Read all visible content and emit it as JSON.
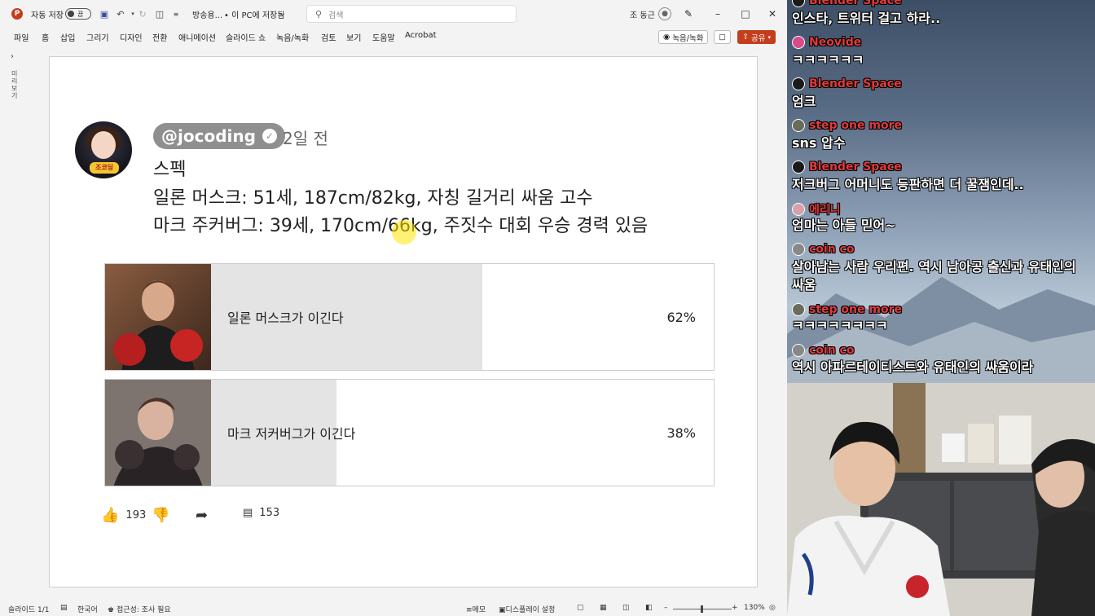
{
  "ppt": {
    "autosave_label": "자동 저장",
    "autosave_state": "끔",
    "doc_title": "방송용...",
    "save_location": "• 이 PC에 저장됨",
    "search_placeholder": "검색",
    "user_name": "조 동근",
    "menu": [
      "파일",
      "홈",
      "삽입",
      "그리기",
      "디자인",
      "전환",
      "애니메이션",
      "슬라이드 쇼",
      "녹음/녹화",
      "검토",
      "보기",
      "도움말",
      "Acrobat"
    ],
    "record_button": "녹음/녹화",
    "share_button": "공유",
    "thumbnail_label": "미리 보기",
    "status": {
      "slide_counter": "슬라이드 1/1",
      "language": "한국어",
      "accessibility": "접근성: 조사 필요",
      "notes": "메모",
      "display_settings": "디스플레이 설정",
      "zoom": "130%"
    }
  },
  "post": {
    "handle": "@jocoding",
    "time_ago": "2일 전",
    "avatar_tag": "조코딩",
    "lines": [
      "스펙",
      "일론 머스크: 51세, 187cm/82kg, 자칭 길거리 싸움 고수",
      "마크 주커버그: 39세, 170cm/66kg, 주짓수 대회 우승 경력 있음"
    ],
    "poll": [
      {
        "label": "일론 머스크가 이긴다",
        "percent_label": "62%",
        "percent": 62
      },
      {
        "label": "마크 저커버그가 이긴다",
        "percent_label": "38%",
        "percent": 38
      }
    ],
    "likes": "193",
    "comments": "153"
  },
  "chat": [
    {
      "user": "Blender Space",
      "text": "인스타, 트위터 걸고 하라..",
      "badge_color": "#1a1a1a"
    },
    {
      "user": "Neovide",
      "text": "ㅋㅋㅋㅋㅋㅋ",
      "badge_color": "#d94a8c"
    },
    {
      "user": "Blender Space",
      "text": "엄크",
      "badge_color": "#1a1a1a"
    },
    {
      "user": "step one more",
      "text": "sns 압수",
      "badge_color": "#6b6b5a"
    },
    {
      "user": "Blender Space",
      "text": "저크버그 어머니도 등판하면 더 꿀잼인데..",
      "badge_color": "#1a1a1a"
    },
    {
      "user": "에리니",
      "text": "엄마는 아들 믿어~",
      "badge_color": "#d8a0a8"
    },
    {
      "user": "coin co",
      "text": "살아남는 사람 우리편. 역시 남아공 출신과 유태인의 싸움",
      "badge_color": "#888888"
    },
    {
      "user": "step one more",
      "text": "ㅋㅋㅋㅋㅋㅋㅋㅋ",
      "badge_color": "#6b6b5a"
    },
    {
      "user": "coin co",
      "text": "역시 아파르테이티스트와 유태인의 싸움이라",
      "badge_color": "#888888"
    }
  ],
  "colors": {
    "ppt_accent": "#c43e1c",
    "poll_fill": "#e4e4e4",
    "chat_username": "#e23a3a"
  }
}
